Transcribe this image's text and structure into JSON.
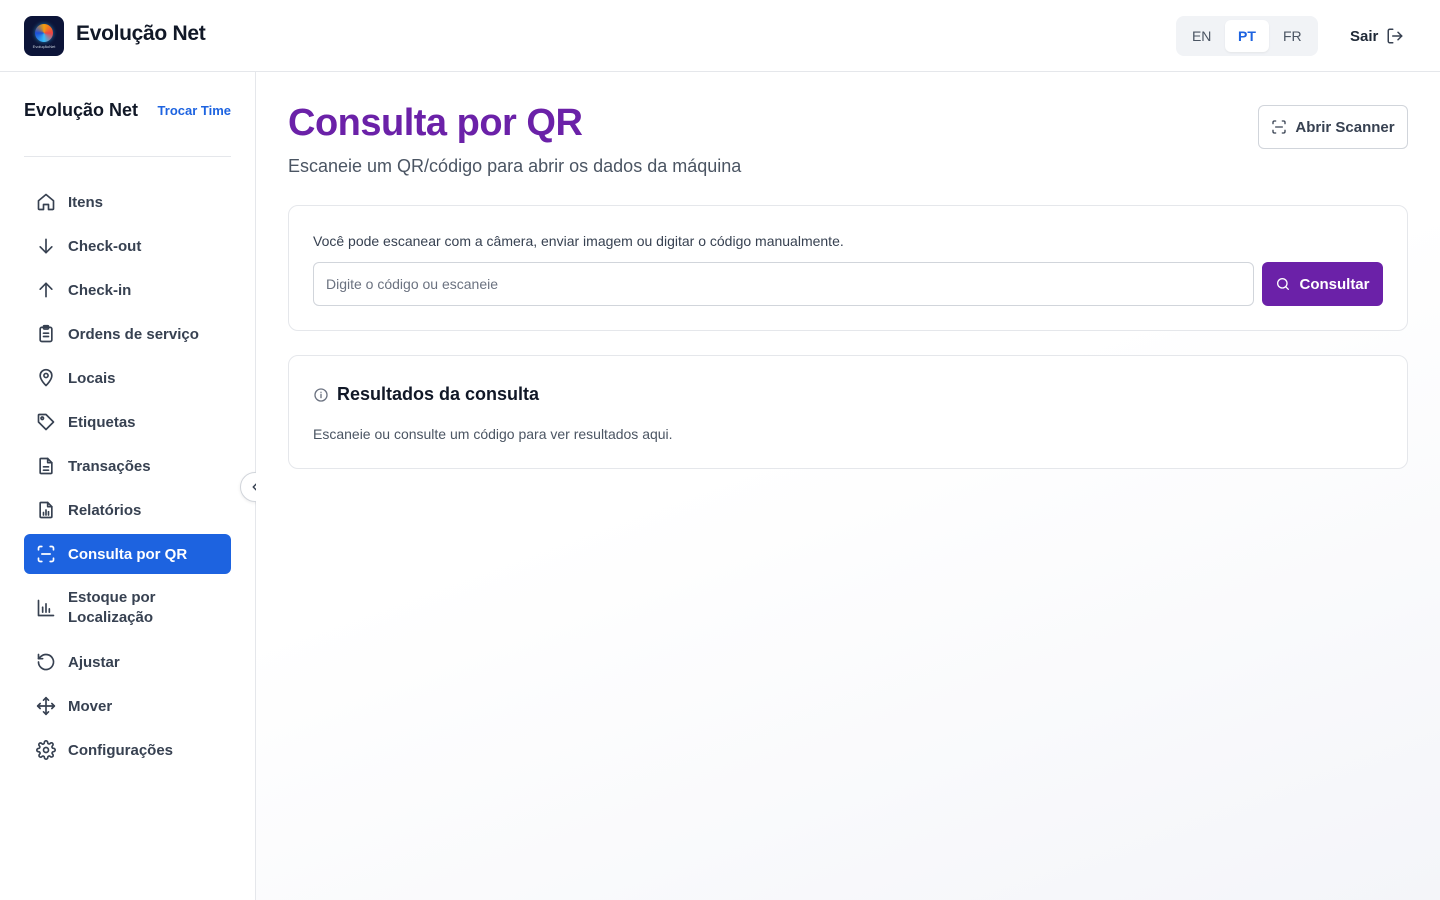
{
  "header": {
    "brand": "Evolução Net",
    "logo_text": "EvoluçãoNet",
    "languages": [
      {
        "code": "EN",
        "active": false
      },
      {
        "code": "PT",
        "active": true
      },
      {
        "code": "FR",
        "active": false
      }
    ],
    "logout_label": "Sair"
  },
  "sidebar": {
    "team_name": "Evolução Net",
    "switch_team_label": "Trocar Time",
    "items": [
      {
        "label": "Itens",
        "icon": "home-icon"
      },
      {
        "label": "Check-out",
        "icon": "arrow-down-icon"
      },
      {
        "label": "Check-in",
        "icon": "arrow-up-icon"
      },
      {
        "label": "Ordens de serviço",
        "icon": "clipboard-icon"
      },
      {
        "label": "Locais",
        "icon": "map-pin-icon"
      },
      {
        "label": "Etiquetas",
        "icon": "tag-icon"
      },
      {
        "label": "Transações",
        "icon": "document-icon"
      },
      {
        "label": "Relatórios",
        "icon": "report-icon"
      },
      {
        "label": "Consulta por QR",
        "icon": "scan-icon",
        "active": true
      },
      {
        "label": "Estoque por Localização",
        "icon": "bar-chart-icon"
      },
      {
        "label": "Ajustar",
        "icon": "rotate-icon"
      },
      {
        "label": "Mover",
        "icon": "move-icon"
      },
      {
        "label": "Configurações",
        "icon": "settings-icon"
      }
    ]
  },
  "main": {
    "title": "Consulta por QR",
    "subtitle": "Escaneie um QR/código para abrir os dados da máquina",
    "open_scanner_label": "Abrir Scanner",
    "search": {
      "hint": "Você pode escanear com a câmera, enviar imagem ou digitar o código manualmente.",
      "placeholder": "Digite o código ou escaneie",
      "value": "",
      "submit_label": "Consultar"
    },
    "results": {
      "title": "Resultados da consulta",
      "empty_text": "Escaneie ou consulte um código para ver resultados aqui."
    }
  },
  "colors": {
    "accent_blue": "#1d63e0",
    "accent_purple": "#6b21a8",
    "border": "#e5e7eb"
  }
}
